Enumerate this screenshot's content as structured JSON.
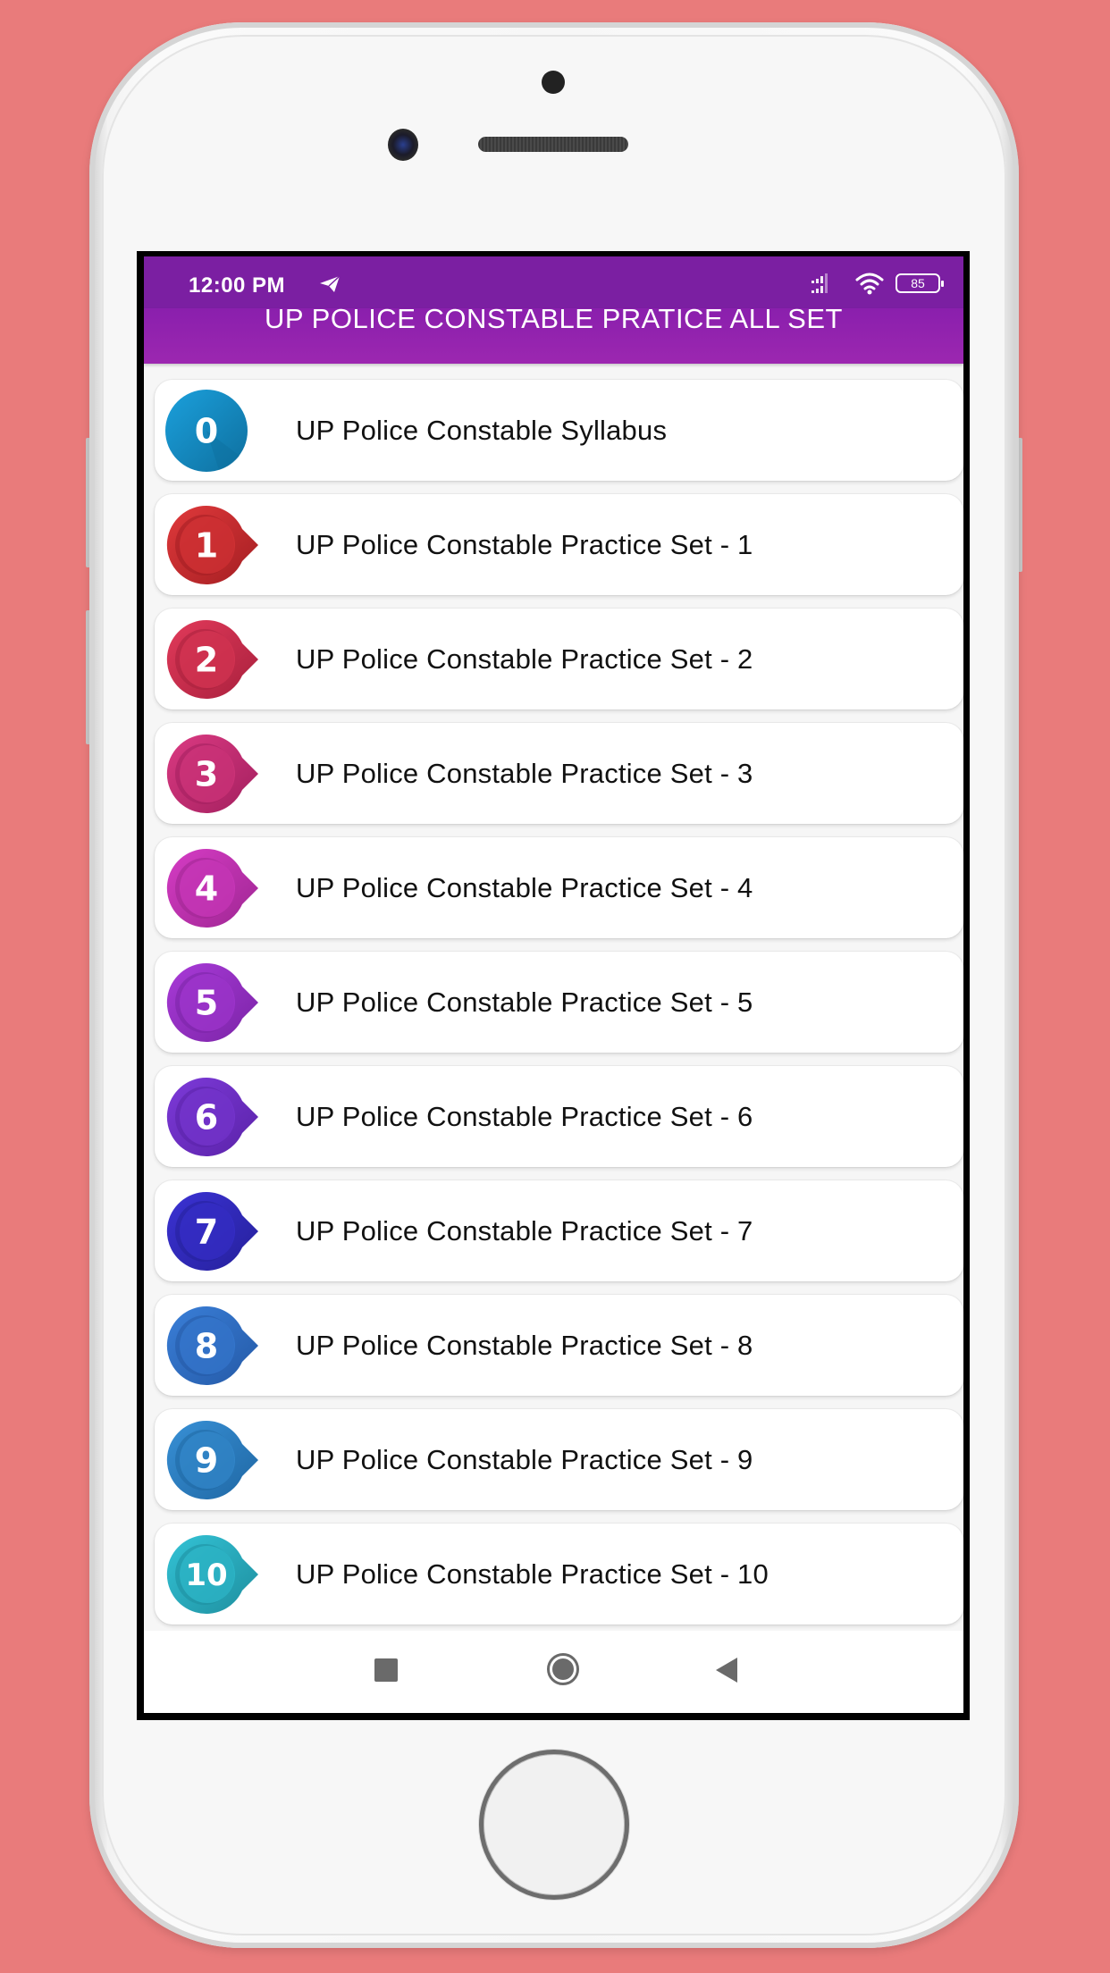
{
  "status_bar": {
    "time": "12:00 PM",
    "battery": "85",
    "icons": [
      "telegram-icon",
      "signal-icon",
      "wifi-icon",
      "battery-icon"
    ]
  },
  "app_bar": {
    "title": "UP POLICE CONSTABLE PRATICE ALL SET"
  },
  "list": {
    "items": [
      {
        "badge": "0",
        "label": "UP Police Constable Syllabus",
        "color": "#1BA0DC",
        "dark": "#0E6F9E",
        "shape": "circle"
      },
      {
        "badge": "1",
        "label": "UP Police Constable Practice Set - 1",
        "color": "#E0393B",
        "dark": "#A31E22",
        "shape": "bubble"
      },
      {
        "badge": "2",
        "label": "UP Police Constable Practice Set - 2",
        "color": "#E23A5A",
        "dark": "#A8203D",
        "shape": "bubble"
      },
      {
        "badge": "3",
        "label": "UP Police Constable Practice Set - 3",
        "color": "#DB3A82",
        "dark": "#A21F5E",
        "shape": "bubble"
      },
      {
        "badge": "4",
        "label": "UP Police Constable Practice Set - 4",
        "color": "#D63CC5",
        "dark": "#9E2692",
        "shape": "bubble"
      },
      {
        "badge": "5",
        "label": "UP Police Constable Practice Set - 5",
        "color": "#A93AD8",
        "dark": "#7A24A6",
        "shape": "bubble"
      },
      {
        "badge": "6",
        "label": "UP Police Constable Practice Set - 6",
        "color": "#7D3AD9",
        "dark": "#5A22A8",
        "shape": "bubble"
      },
      {
        "badge": "7",
        "label": "UP Police Constable Practice Set - 7",
        "color": "#3B32D4",
        "dark": "#25209A",
        "shape": "bubble"
      },
      {
        "badge": "8",
        "label": "UP Police Constable Practice Set - 8",
        "color": "#3A7FD8",
        "dark": "#2459A6",
        "shape": "bubble"
      },
      {
        "badge": "9",
        "label": "UP Police Constable Practice Set - 9",
        "color": "#3890D6",
        "dark": "#1F67A3",
        "shape": "bubble"
      },
      {
        "badge": "10",
        "label": "UP Police Constable Practice Set - 10",
        "color": "#33C3D6",
        "dark": "#1E8E9E",
        "shape": "bubble"
      }
    ]
  },
  "nav_bar": {
    "buttons": [
      "recents-icon",
      "home-icon",
      "back-icon"
    ]
  }
}
